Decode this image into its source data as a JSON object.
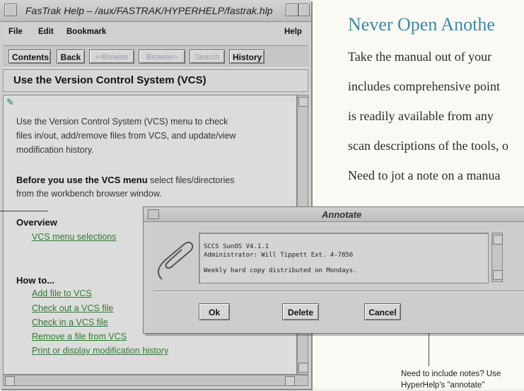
{
  "help_window": {
    "title": "FasTrak Help – /aux/FASTRAK/HYPERHELP/fastrak.hlp",
    "menu": {
      "file": "File",
      "edit": "Edit",
      "bookmark": "Bookmark",
      "help": "Help"
    },
    "toolbar": {
      "contents": "Contents",
      "back": "Back",
      "browse_back": "«‹Browse",
      "browse_fwd": "Browse››",
      "search": "Search",
      "history": "History"
    },
    "topic_title": "Use the Version Control System (VCS)",
    "intro_lines": [
      "Use the Version Control System (VCS) menu to check",
      "files in/out, add/remove files from VCS, and update/view",
      "modification history."
    ],
    "before_bold": "Before you use the VCS menu",
    "before_rest": " select files/directories",
    "before_line2": "from the workbench browser window.",
    "overview_heading": "Overview",
    "overview_links": [
      "VCS menu selections"
    ],
    "howto_heading": "How to...",
    "howto_links": [
      "Add  file to VCS",
      "Check out a VCS file",
      "Check in a VCS file",
      "Remove a file from VCS",
      "Print or display modification history"
    ]
  },
  "annotate_dialog": {
    "title": "Annotate",
    "note_lines": [
      "SCCS SunOS V4.1.1",
      "Administrator: Will Tippett  Ext. 4-7856",
      "Weekly hard copy distributed on Mondays."
    ],
    "buttons": {
      "ok": "Ok",
      "delete": "Delete",
      "cancel": "Cancel"
    }
  },
  "brochure": {
    "heading": "Never Open Anothe",
    "body_lines": [
      "Take the manual out of your",
      "includes comprehensive point",
      "is readily available from any",
      "scan descriptions of the tools, o",
      "Need to jot a note on a manua"
    ],
    "caption_lines": [
      "Need to include notes? Use",
      "HyperHelp's \"annotate\""
    ]
  }
}
